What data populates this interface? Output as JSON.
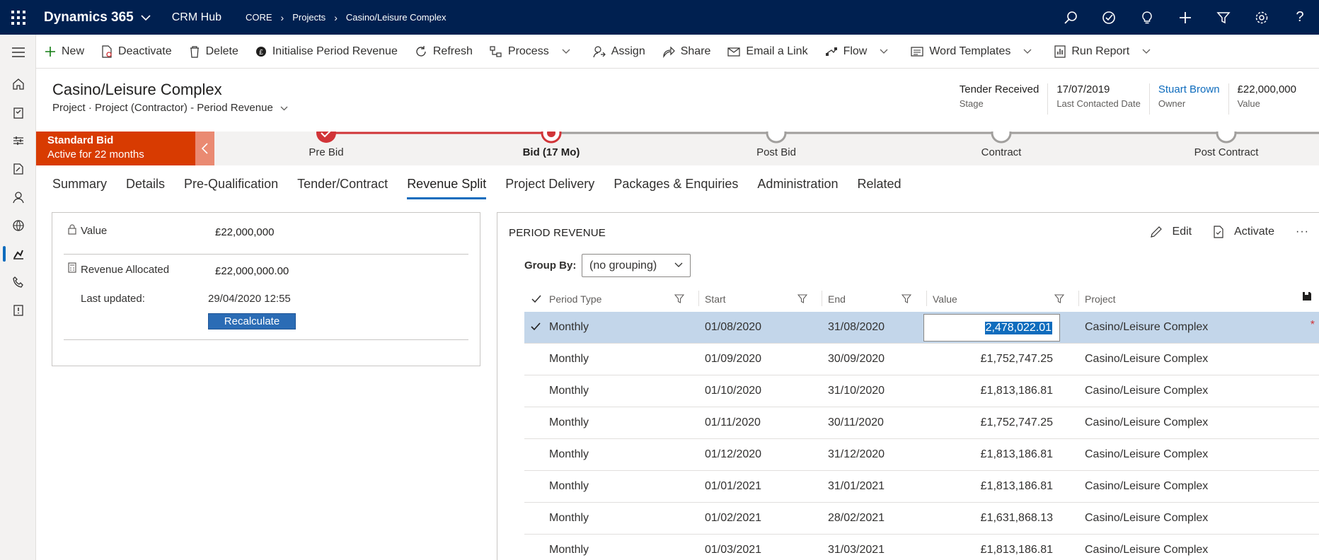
{
  "app": {
    "name": "Dynamics 365",
    "hub": "CRM Hub",
    "breadcrumb": [
      "CORE",
      "Projects",
      "Casino/Leisure Complex"
    ]
  },
  "commands": [
    {
      "label": "New",
      "icon": "plus-icon"
    },
    {
      "label": "Deactivate",
      "icon": "deactivate-icon"
    },
    {
      "label": "Delete",
      "icon": "trash-icon"
    },
    {
      "label": "Initialise Period Revenue",
      "icon": "revenue-icon"
    },
    {
      "label": "Refresh",
      "icon": "refresh-icon"
    },
    {
      "label": "Process",
      "icon": "process-icon"
    },
    {
      "label": "Assign",
      "icon": "assign-icon"
    },
    {
      "label": "Share",
      "icon": "share-icon"
    },
    {
      "label": "Email a Link",
      "icon": "email-icon"
    },
    {
      "label": "Flow",
      "icon": "flow-icon"
    },
    {
      "label": "Word Templates",
      "icon": "word-icon"
    },
    {
      "label": "Run Report",
      "icon": "report-icon"
    }
  ],
  "record": {
    "title": "Casino/Leisure Complex",
    "entity": "Project",
    "form": "Project (Contractor) - Period Revenue"
  },
  "header_fields": [
    {
      "value": "Tender Received",
      "label": "Stage"
    },
    {
      "value": "17/07/2019",
      "label": "Last Contacted Date"
    },
    {
      "value": "Stuart Brown",
      "label": "Owner"
    },
    {
      "value": "£22,000,000",
      "label": "Value"
    }
  ],
  "bpf": {
    "name": "Standard Bid",
    "status": "Active for 22 months",
    "stages": [
      "Pre Bid",
      "Bid  (17 Mo)",
      "Post Bid",
      "Contract",
      "Post Contract"
    ],
    "active_stage_index": 1
  },
  "tabs": [
    "Summary",
    "Details",
    "Pre-Qualification",
    "Tender/Contract",
    "Revenue Split",
    "Project Delivery",
    "Packages & Enquiries",
    "Administration",
    "Related"
  ],
  "active_tab": "Revenue Split",
  "left_panel": {
    "value_label": "Value",
    "value": "£22,000,000",
    "revenue_allocated_label": "Revenue Allocated",
    "revenue_allocated": "£22,000,000.00",
    "last_updated_label": "Last updated:",
    "last_updated": "29/04/2020 12:55",
    "recalculate_label": "Recalculate"
  },
  "period_revenue": {
    "title": "PERIOD REVENUE",
    "edit_label": "Edit",
    "activate_label": "Activate",
    "more_label": "···",
    "group_by_label": "Group By:",
    "group_by_value": "(no grouping)",
    "columns": [
      "Period Type",
      "Start",
      "End",
      "Value",
      "Project"
    ],
    "rows": [
      {
        "type": "Monthly",
        "start": "01/08/2020",
        "end": "31/08/2020",
        "value": "2,478,022.01",
        "project": "Casino/Leisure Complex"
      },
      {
        "type": "Monthly",
        "start": "01/09/2020",
        "end": "30/09/2020",
        "value": "£1,752,747.25",
        "project": "Casino/Leisure Complex"
      },
      {
        "type": "Monthly",
        "start": "01/10/2020",
        "end": "31/10/2020",
        "value": "£1,813,186.81",
        "project": "Casino/Leisure Complex"
      },
      {
        "type": "Monthly",
        "start": "01/11/2020",
        "end": "30/11/2020",
        "value": "£1,752,747.25",
        "project": "Casino/Leisure Complex"
      },
      {
        "type": "Monthly",
        "start": "01/12/2020",
        "end": "31/12/2020",
        "value": "£1,813,186.81",
        "project": "Casino/Leisure Complex"
      },
      {
        "type": "Monthly",
        "start": "01/01/2021",
        "end": "31/01/2021",
        "value": "£1,813,186.81",
        "project": "Casino/Leisure Complex"
      },
      {
        "type": "Monthly",
        "start": "01/02/2021",
        "end": "28/02/2021",
        "value": "£1,631,868.13",
        "project": "Casino/Leisure Complex"
      },
      {
        "type": "Monthly",
        "start": "01/03/2021",
        "end": "31/03/2021",
        "value": "£1,813,186.81",
        "project": "Casino/Leisure Complex"
      }
    ],
    "required_marker": "*"
  },
  "colors": {
    "topbar": "#002050",
    "bpf_active": "#d83b01",
    "bpf_progress": "#d13438",
    "accent": "#0f6cbd",
    "selected_row": "#c3d6ea"
  }
}
